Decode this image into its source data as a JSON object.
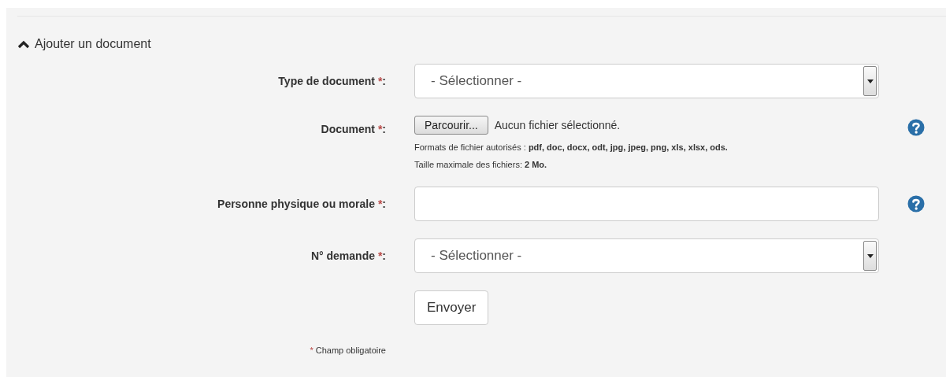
{
  "section": {
    "title": "Ajouter un document",
    "expanded": true
  },
  "fields": [
    {
      "kind": "select",
      "label": "Type de document ",
      "required_mark": "*",
      "suffix": ":",
      "value": "- Sélectionner -",
      "help": false
    },
    {
      "kind": "file",
      "label": "Document ",
      "required_mark": "*",
      "suffix": ":",
      "button": "Parcourir...",
      "status": "Aucun fichier sélectionné.",
      "hints": [
        "Formats de fichier autorisés : **pdf, doc, docx, odt, jpg, jpeg, png, xls, xlsx, ods.**",
        "Taille maximale des fichiers: **2 Mo.**"
      ],
      "help": true
    },
    {
      "kind": "text",
      "label": "Personne physique ou morale ",
      "required_mark": "*",
      "suffix": ":",
      "help": true
    },
    {
      "kind": "select",
      "label": "N° demande ",
      "required_mark": "*",
      "suffix": ":",
      "value": "- Sélectionner -",
      "help": false
    }
  ],
  "submit": "Envoyer",
  "footnote": {
    "mark": "*",
    "text": "Champ obligatoire"
  }
}
